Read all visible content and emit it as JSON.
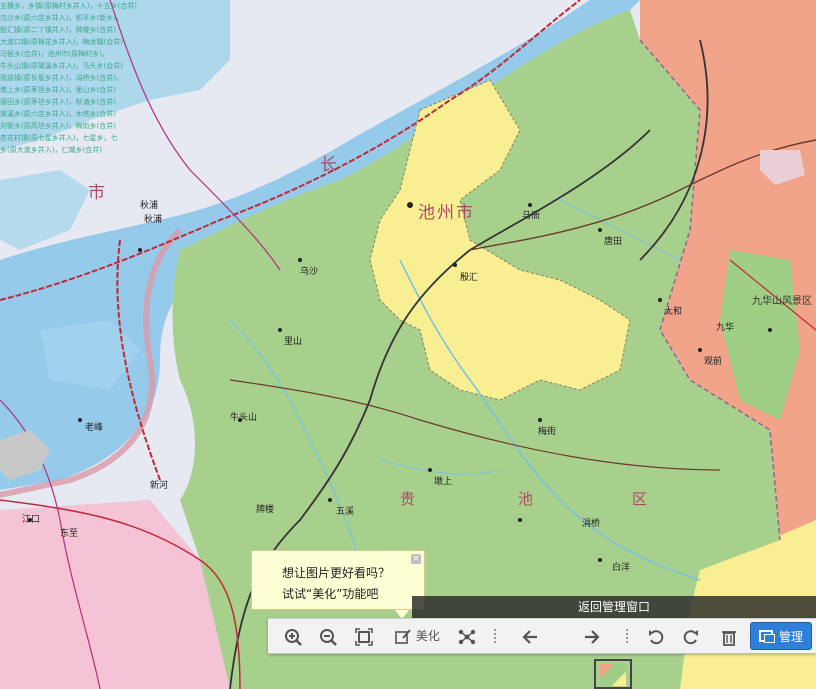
{
  "map": {
    "district_title": "贵池区",
    "city_label": "池州市",
    "labels": {
      "city_char": "市",
      "changjiang": "长",
      "county_huaishang": "九华山风景区",
      "anqing_west": "秋浦",
      "places": [
        "牛头山",
        "殷汇",
        "马衙",
        "新河",
        "老峰",
        "九华",
        "白洋",
        "东至",
        "江口",
        "梅街",
        "太和",
        "涓桥",
        "乌沙",
        "五溪",
        "牌楼",
        "里山",
        "墩上",
        "唐田",
        "观前",
        "秋浦"
      ]
    },
    "notes": [
      "五横乡，乡镇(原梅村乡并入)，十五乡(合并)",
      "乌沙乡(原六店乡并入)，和平乡(新乡)，",
      "殷汇镇(原二丫镇并入)，牌楼乡(合并)",
      "大渡口镇(原棉花乡并入)，梅龙镇(合并)",
      "马衙乡(合并)，池州市(原梅村乡)，",
      "牛头山镇(原棠溪乡并入)，马头乡(合并)",
      "观前镇(原长坂乡并入)，涓桥乡(合并)，",
      "墩上乡(原茅坦乡并入)，里山乡(合并)",
      "唐田乡(原茅坦乡并入)，秋浦乡(合并)",
      "棠溪乡(原六店乡并入)，木塔乡(合并)",
      "刘街乡(原高坦乡并入)，梅街乡(合并)",
      "杏花村镇(原七星乡并入)，七星乡，七",
      "乡(原大渡乡并入)，仁城乡(合并)"
    ],
    "colors": {
      "district_green": "#a8d08d",
      "urban_yellow": "#f8ef92",
      "neighbor_pink": "#f1a48a",
      "river_blue": "#79bfe6",
      "railway": "#c0293a"
    }
  },
  "tooltip": {
    "line1": "想让图片更好看吗？",
    "line2": "试试“美化”功能吧",
    "close": "×"
  },
  "return_bar": {
    "label": "返回管理窗口"
  },
  "toolbar": {
    "zoom_in": "zoom-in-icon",
    "zoom_out": "zoom-out-icon",
    "fit": "fit-screen-icon",
    "beautify_label": "美化",
    "share": "share-icon",
    "prev": "arrow-left-icon",
    "next": "arrow-right-icon",
    "rotate_left": "rotate-ccw-icon",
    "rotate_right": "rotate-cw-icon",
    "delete": "trash-icon",
    "manage_label": "管理"
  }
}
